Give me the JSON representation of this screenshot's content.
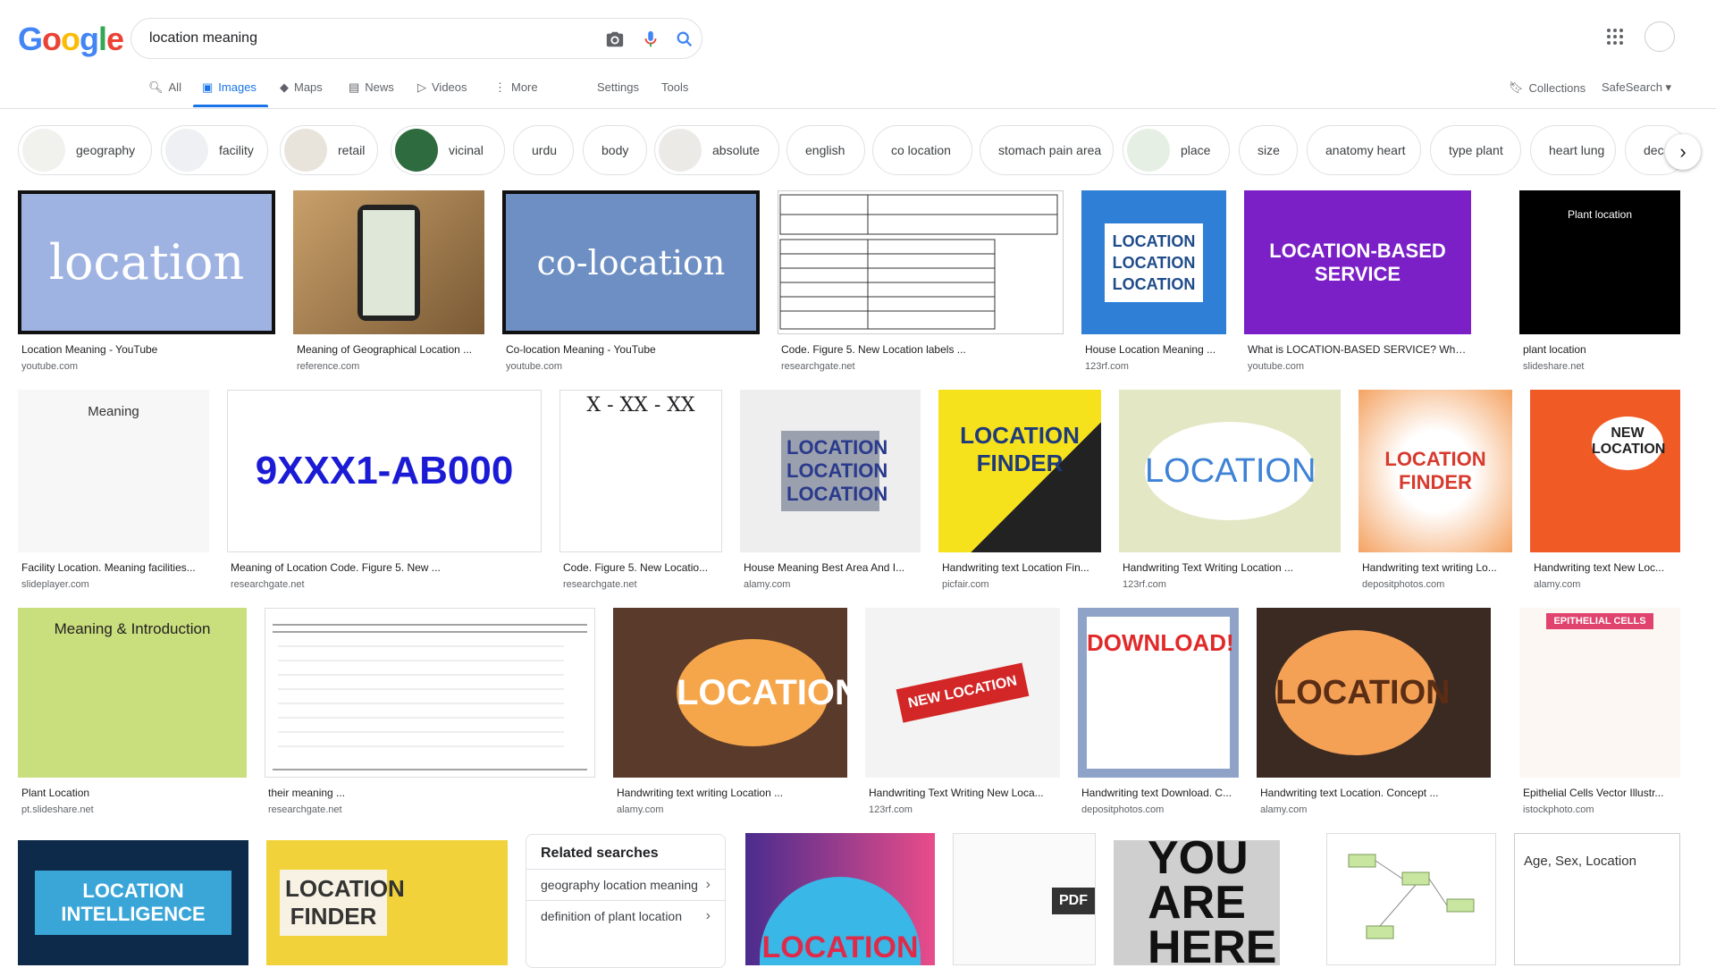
{
  "search": {
    "query": "location meaning"
  },
  "logo": {
    "letters": [
      "G",
      "o",
      "o",
      "g",
      "l",
      "e"
    ],
    "colors": [
      "#4285F4",
      "#EA4335",
      "#FBBC05",
      "#4285F4",
      "#34A853",
      "#EA4335"
    ]
  },
  "tabs": [
    {
      "label": "All",
      "icon": "search-icon"
    },
    {
      "label": "Images",
      "icon": "image-icon"
    },
    {
      "label": "Maps",
      "icon": "map-icon"
    },
    {
      "label": "News",
      "icon": "news-icon"
    },
    {
      "label": "Videos",
      "icon": "play-icon"
    },
    {
      "label": "More",
      "icon": "more-vert-icon"
    }
  ],
  "settings_label": "Settings",
  "tools_label": "Tools",
  "collections_label": "Collections",
  "safesearch_label": "SafeSearch",
  "chips": [
    "geography",
    "facility",
    "retail",
    "vicinal",
    "urdu",
    "body",
    "absolute",
    "english",
    "co location",
    "stomach pain area",
    "place",
    "size",
    "anatomy heart",
    "type plant",
    "heart lung",
    "dec"
  ],
  "results": [
    {
      "title": "Location Meaning - YouTube",
      "source": "youtube.com",
      "text": "location"
    },
    {
      "title": "Meaning of Geographical Location ...",
      "source": "reference.com",
      "text": ""
    },
    {
      "title": "Co-location Meaning - YouTube",
      "source": "youtube.com",
      "text": "co-location"
    },
    {
      "title": "Code. Figure 5. New Location labels ...",
      "source": "researchgate.net",
      "text": ""
    },
    {
      "title": "House Location Meaning ...",
      "source": "123rf.com",
      "text": "LOCATION LOCATION LOCATION"
    },
    {
      "title": "What is LOCATION-BASED SERVICE? What ...",
      "source": "youtube.com",
      "text": "LOCATION-BASED SERVICE"
    },
    {
      "title": "plant location",
      "source": "slideshare.net",
      "text": "Plant location"
    },
    {
      "title": "Facility Location. Meaning facilities...",
      "source": "slideplayer.com",
      "text": "Meaning"
    },
    {
      "title": "Meaning of Location Code. Figure 5. New ...",
      "source": "researchgate.net",
      "text": "9XXX1-AB000"
    },
    {
      "title": "Code. Figure 5. New Locatio...",
      "source": "researchgate.net",
      "text": "X - XX - XX"
    },
    {
      "title": "House Meaning Best Area And I...",
      "source": "alamy.com",
      "text": "LOCATION LOCATION LOCATION"
    },
    {
      "title": "Handwriting text Location Fin...",
      "source": "picfair.com",
      "text": "LOCATION FINDER"
    },
    {
      "title": "Handwriting Text Writing Location ...",
      "source": "123rf.com",
      "text": "LOCATION"
    },
    {
      "title": "Handwriting text writing Lo...",
      "source": "depositphotos.com",
      "text": "LOCATION FINDER"
    },
    {
      "title": "Handwriting text New Loc...",
      "source": "alamy.com",
      "text": "NEW LOCATION"
    },
    {
      "title": "Plant Location",
      "source": "pt.slideshare.net",
      "text": "Meaning & Introduction"
    },
    {
      "title": "their meaning ...",
      "source": "researchgate.net",
      "text": ""
    },
    {
      "title": "Handwriting text writing Location ...",
      "source": "alamy.com",
      "text": "LOCATION"
    },
    {
      "title": "Handwriting Text Writing New Loca...",
      "source": "123rf.com",
      "text": "NEW LOCATION"
    },
    {
      "title": "Handwriting text Download. C...",
      "source": "depositphotos.com",
      "text": "DOWNLOAD!"
    },
    {
      "title": "Handwriting text Location. Concept ...",
      "source": "alamy.com",
      "text": "LOCATION"
    },
    {
      "title": "Epithelial Cells Vector Illustr...",
      "source": "istockphoto.com",
      "text": "EPITHELIAL CELLS"
    }
  ],
  "bottom_images": [
    "LOCATION INTELLIGENCE",
    "LOCATION FINDER",
    "LOCATION",
    "PDF",
    "YOU ARE HERE",
    "",
    "Age, Sex, Location"
  ],
  "related": {
    "title": "Related searches",
    "items": [
      "geography location meaning",
      "definition of plant location"
    ]
  }
}
